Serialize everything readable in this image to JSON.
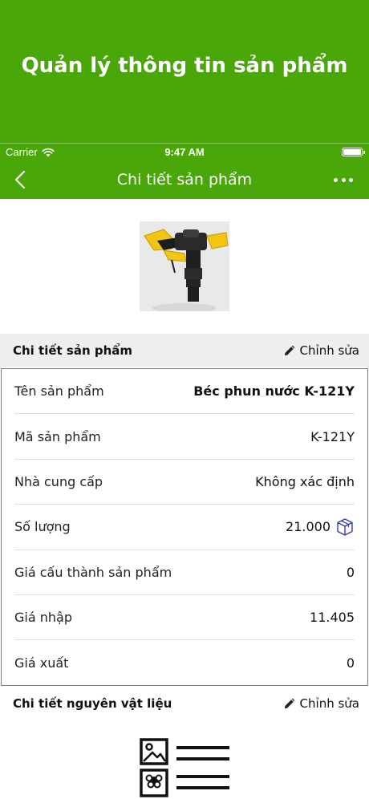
{
  "banner": {
    "title": "Quản lý thông tin sản phẩm"
  },
  "status_bar": {
    "carrier": "Carrier",
    "time": "9:47 AM",
    "battery_level": 1.0
  },
  "nav": {
    "title": "Chi tiết sản phẩm",
    "back_icon": "chevron-left-icon",
    "more_icon": "more-horizontal-icon"
  },
  "product": {
    "image_alt": "sprinkler-photo"
  },
  "details_section": {
    "title": "Chi tiết sản phẩm",
    "edit_label": "Chỉnh sửa"
  },
  "details": [
    {
      "label": "Tên sản phẩm",
      "value": "Béc phun nước K-121Y"
    },
    {
      "label": "Mã sản phẩm",
      "value": "K-121Y"
    },
    {
      "label": "Nhà cung cấp",
      "value": "Không xác định"
    },
    {
      "label": "Số lượng",
      "value": "21.000"
    },
    {
      "label": "Giá cấu thành sản phẩm",
      "value": "0"
    },
    {
      "label": "Giá nhập",
      "value": "11.405"
    },
    {
      "label": "Giá xuất",
      "value": "0"
    }
  ],
  "materials_section": {
    "title": "Chi tiết nguyên vật liệu",
    "edit_label": "Chỉnh sửa"
  },
  "colors": {
    "brand_green": "#4aa70a",
    "box_icon": "#3a3aa8"
  }
}
